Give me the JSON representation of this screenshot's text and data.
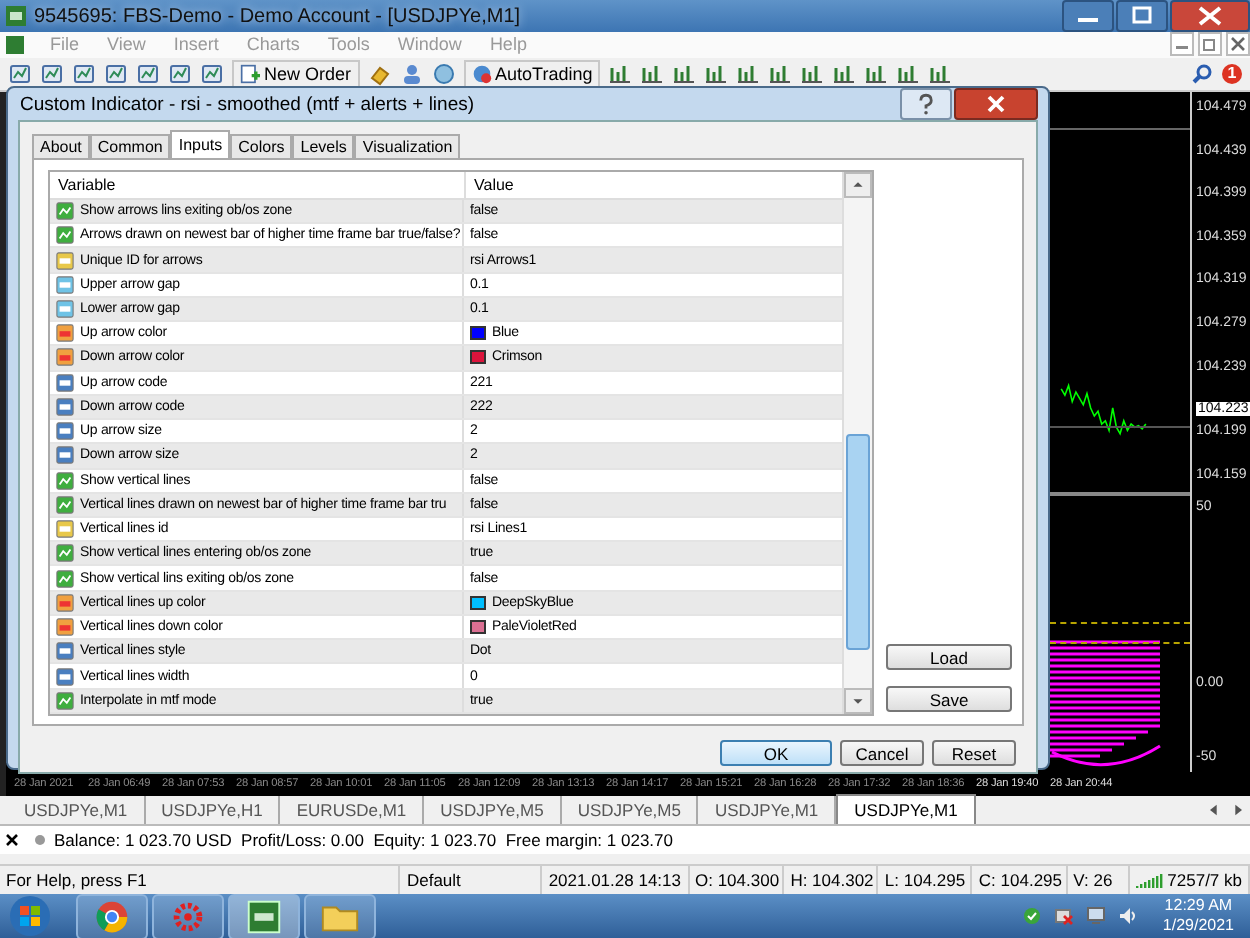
{
  "window": {
    "title": "9545695: FBS-Demo - Demo Account - [USDJPYe,M1]"
  },
  "menu": [
    {
      "label": "File",
      "disabled": true
    },
    {
      "label": "View",
      "disabled": true
    },
    {
      "label": "Insert",
      "disabled": true
    },
    {
      "label": "Charts",
      "disabled": true
    },
    {
      "label": "Tools",
      "disabled": true
    },
    {
      "label": "Window",
      "disabled": true
    },
    {
      "label": "Help",
      "disabled": true
    }
  ],
  "toolbar": {
    "new_order": "New Order",
    "autotrading": "AutoTrading",
    "notification_count": "1"
  },
  "dialog": {
    "title": "Custom Indicator - rsi - smoothed (mtf + alerts + lines)",
    "tabs": [
      {
        "label": "About",
        "selected": false
      },
      {
        "label": "Common",
        "selected": false
      },
      {
        "label": "Inputs",
        "selected": true
      },
      {
        "label": "Colors",
        "selected": false
      },
      {
        "label": "Levels",
        "selected": false
      },
      {
        "label": "Visualization",
        "selected": false
      }
    ],
    "columns": [
      "Variable",
      "Value"
    ],
    "rows": [
      {
        "kind": "bool",
        "variable": "Show arrows lins exiting ob/os zone",
        "value": "false"
      },
      {
        "kind": "bool",
        "variable": "Arrows drawn on newest bar of higher time frame bar true/false?",
        "value": "false"
      },
      {
        "kind": "string",
        "variable": "Unique ID for arrows",
        "value": "rsi Arrows1"
      },
      {
        "kind": "double",
        "variable": "Upper arrow gap",
        "value": "0.1"
      },
      {
        "kind": "double",
        "variable": "Lower arrow gap",
        "value": "0.1"
      },
      {
        "kind": "color",
        "variable": "Up arrow color",
        "value": "Blue",
        "color": "#0000ff"
      },
      {
        "kind": "color",
        "variable": "Down arrow color",
        "value": "Crimson",
        "color": "#dc143c"
      },
      {
        "kind": "int",
        "variable": "Up arrow code",
        "value": "221"
      },
      {
        "kind": "int",
        "variable": "Down arrow code",
        "value": "222"
      },
      {
        "kind": "int",
        "variable": "Up arrow size",
        "value": "2"
      },
      {
        "kind": "int",
        "variable": "Down arrow size",
        "value": "2"
      },
      {
        "kind": "bool",
        "variable": "Show vertical lines",
        "value": "false"
      },
      {
        "kind": "bool",
        "variable": "Vertical lines drawn on newest bar of higher time frame bar tru",
        "value": "false"
      },
      {
        "kind": "string",
        "variable": "Vertical lines id",
        "value": "rsi Lines1"
      },
      {
        "kind": "bool",
        "variable": "Show vertical lines entering ob/os zone",
        "value": "true"
      },
      {
        "kind": "bool",
        "variable": "Show vertical lins exiting ob/os zone",
        "value": "false"
      },
      {
        "kind": "color",
        "variable": "Vertical lines up color",
        "value": "DeepSkyBlue",
        "color": "#00bfff"
      },
      {
        "kind": "color",
        "variable": "Vertical lines down color",
        "value": "PaleVioletRed",
        "color": "#db7093"
      },
      {
        "kind": "int",
        "variable": "Vertical lines style",
        "value": "Dot"
      },
      {
        "kind": "int",
        "variable": "Vertical lines width",
        "value": "0"
      },
      {
        "kind": "bool",
        "variable": "Interpolate in mtf mode",
        "value": "true"
      }
    ],
    "side_buttons": [
      "Load",
      "Save"
    ],
    "buttons": [
      "OK",
      "Cancel",
      "Reset"
    ]
  },
  "chart": {
    "price_labels": [
      "104.479",
      "104.439",
      "104.399",
      "104.359",
      "104.319",
      "104.279",
      "104.239",
      "104.199",
      "104.159"
    ],
    "current_price": "104.223",
    "indicator_labels": [
      "50",
      "0.00",
      "-50"
    ],
    "time_labels": [
      "28 Jan 2021",
      "28 Jan 06:49",
      "28 Jan 07:53",
      "28 Jan 08:57",
      "28 Jan 10:01",
      "28 Jan 11:05",
      "28 Jan 12:09",
      "28 Jan 13:13",
      "28 Jan 14:17",
      "28 Jan 15:21",
      "28 Jan 16:28",
      "28 Jan 17:32",
      "28 Jan 18:36",
      "28 Jan 19:40",
      "28 Jan 20:44"
    ]
  },
  "chart_tabs": [
    {
      "label": "USDJPYe,M1",
      "selected": false
    },
    {
      "label": "USDJPYe,H1",
      "selected": false
    },
    {
      "label": "EURUSDe,M1",
      "selected": false
    },
    {
      "label": "USDJPYe,M5",
      "selected": false
    },
    {
      "label": "USDJPYe,M5",
      "selected": false
    },
    {
      "label": "USDJPYe,M1",
      "selected": false
    },
    {
      "label": "USDJPYe,M1",
      "selected": true
    }
  ],
  "terminal": {
    "summary": "Balance: 1 023.70 USD  Profit/Loss: 0.00  Equity: 1 023.70  Free margin: 1 023.70"
  },
  "status_bar": [
    "For Help, press F1",
    "Default",
    "2021.01.28 14:13",
    "O: 104.300",
    "H: 104.302",
    "L: 104.295",
    "C: 104.295",
    "V: 26",
    "7257/7 kb"
  ],
  "taskbar": {
    "time": "12:29 AM",
    "date": "1/29/2021"
  }
}
